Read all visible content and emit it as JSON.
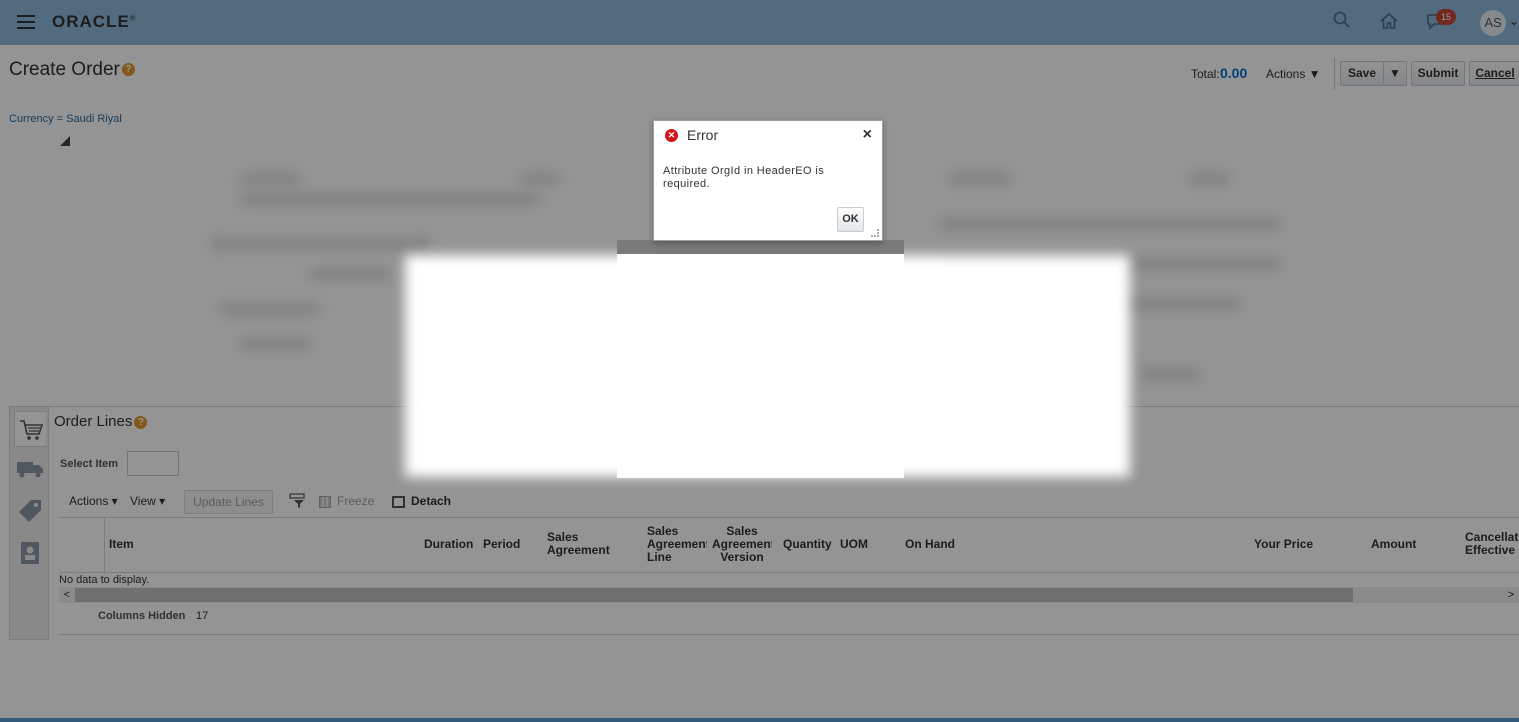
{
  "header": {
    "logo": "ORACLE",
    "logo_mark": "®",
    "notification_count": "15",
    "user_initials": "AS"
  },
  "page": {
    "title": "Create Order",
    "total_label": "Total:",
    "total_value": "0.00",
    "actions_label": "Actions ▼",
    "save_label": "Save",
    "submit_label": "Submit",
    "cancel_label": "Cancel",
    "currency": "Currency = Saudi Riyal"
  },
  "order_lines": {
    "title": "Order Lines",
    "select_item_label": "Select Item",
    "toolbar": {
      "actions": "Actions ▾",
      "view": "View ▾",
      "update_lines": "Update Lines",
      "freeze": "Freeze",
      "detach": "Detach"
    },
    "columns": [
      "Item",
      "Duration",
      "Period",
      "Sales\nAgreement",
      "Sales\nAgreement\nLine",
      "Sales\nAgreement\nVersion",
      "Quantity",
      "UOM",
      "On Hand",
      "Your Price",
      "Amount",
      "Cancellation\nEffective"
    ],
    "no_data": "No data to display.",
    "columns_hidden_label": "Columns Hidden",
    "columns_hidden_value": "17"
  },
  "dialog": {
    "title": "Error",
    "message": "Attribute OrgId in HeaderEO is required.",
    "ok_label": "OK"
  },
  "colors": {
    "topbar": "#8fb9d9",
    "accent": "#0572ce",
    "error": "#d0151b",
    "badge": "#c74634"
  }
}
